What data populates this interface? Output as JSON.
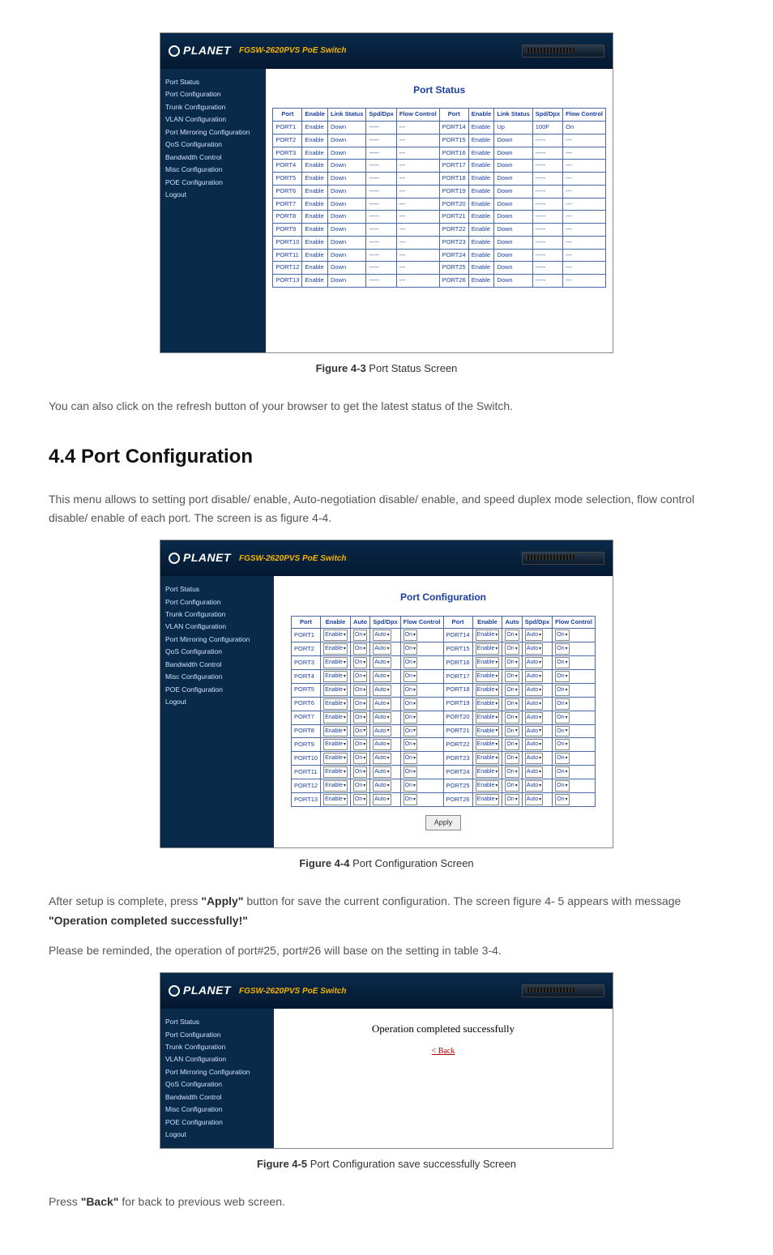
{
  "brand": "PLANET",
  "model": "FGSW-2620PVS PoE Switch",
  "sidebar": {
    "items": [
      "Port Status",
      "Port Configuration",
      "Trunk Configuration",
      "VLAN Configuration",
      "Port Mirroring Configuration",
      "QoS Configuration",
      "Bandwidth Control",
      "Misc Configuration",
      "POE Configuration",
      "Logout"
    ]
  },
  "fig43": {
    "caption_bold": "Figure 4-3",
    "caption_rest": " Port Status Screen",
    "title": "Port Status",
    "headers": [
      "Port",
      "Enable",
      "Link Status",
      "Spd/Dpx",
      "Flow Control",
      "Port",
      "Enable",
      "Link Status",
      "Spd/Dpx",
      "Flow Control"
    ],
    "rows": [
      [
        "PORT1",
        "Enable",
        "Down",
        "-----",
        "---",
        "PORT14",
        "Enable",
        "Up",
        "100F",
        "On"
      ],
      [
        "PORT2",
        "Enable",
        "Down",
        "-----",
        "---",
        "PORT15",
        "Enable",
        "Down",
        "-----",
        "---"
      ],
      [
        "PORT3",
        "Enable",
        "Down",
        "-----",
        "---",
        "PORT16",
        "Enable",
        "Down",
        "-----",
        "---"
      ],
      [
        "PORT4",
        "Enable",
        "Down",
        "-----",
        "---",
        "PORT17",
        "Enable",
        "Down",
        "-----",
        "---"
      ],
      [
        "PORT5",
        "Enable",
        "Down",
        "-----",
        "---",
        "PORT18",
        "Enable",
        "Down",
        "-----",
        "---"
      ],
      [
        "PORT6",
        "Enable",
        "Down",
        "-----",
        "---",
        "PORT19",
        "Enable",
        "Down",
        "-----",
        "---"
      ],
      [
        "PORT7",
        "Enable",
        "Down",
        "-----",
        "---",
        "PORT20",
        "Enable",
        "Down",
        "-----",
        "---"
      ],
      [
        "PORT8",
        "Enable",
        "Down",
        "-----",
        "---",
        "PORT21",
        "Enable",
        "Down",
        "-----",
        "---"
      ],
      [
        "PORT9",
        "Enable",
        "Down",
        "-----",
        "---",
        "PORT22",
        "Enable",
        "Down",
        "-----",
        "---"
      ],
      [
        "PORT10",
        "Enable",
        "Down",
        "-----",
        "---",
        "PORT23",
        "Enable",
        "Down",
        "-----",
        "---"
      ],
      [
        "PORT11",
        "Enable",
        "Down",
        "-----",
        "---",
        "PORT24",
        "Enable",
        "Down",
        "-----",
        "---"
      ],
      [
        "PORT12",
        "Enable",
        "Down",
        "-----",
        "---",
        "PORT25",
        "Enable",
        "Down",
        "-----",
        "---"
      ],
      [
        "PORT13",
        "Enable",
        "Down",
        "-----",
        "---",
        "PORT26",
        "Enable",
        "Down",
        "-----",
        "---"
      ]
    ]
  },
  "text_after_fig43": "You can also click on the refresh button of your browser to get the latest status of the Switch.",
  "section_heading": "4.4 Port Configuration",
  "section_intro": "This menu allows to setting port disable/ enable, Auto-negotiation disable/ enable, and speed duplex mode selection, flow control disable/ enable of each port. The screen is as figure 4-4.",
  "fig44": {
    "caption_bold": "Figure 4-4",
    "caption_rest": " Port Configuration Screen",
    "title": "Port Configuration",
    "headers": [
      "Port",
      "Enable",
      "Auto",
      "Spd/Dpx",
      "Flow Control",
      "Port",
      "Enable",
      "Auto",
      "Spd/Dpx",
      "Flow Control"
    ],
    "left_ports": [
      "PORT1",
      "PORT2",
      "PORT3",
      "PORT4",
      "PORT5",
      "PORT6",
      "PORT7",
      "PORT8",
      "PORT9",
      "PORT10",
      "PORT11",
      "PORT12",
      "PORT13"
    ],
    "right_ports": [
      "PORT14",
      "PORT15",
      "PORT16",
      "PORT17",
      "PORT18",
      "PORT19",
      "PORT20",
      "PORT21",
      "PORT22",
      "PORT23",
      "PORT24",
      "PORT25",
      "PORT26"
    ],
    "sel_enable": "Enable",
    "sel_auto": "On",
    "sel_spd": "Auto",
    "sel_flow": "On",
    "apply_label": "Apply"
  },
  "after_fig44_1a": "After setup is complete, press ",
  "after_fig44_1b": "\"Apply\"",
  "after_fig44_1c": " button for save the current configuration. The screen figure 4- 5 appears with message ",
  "after_fig44_1d": "\"Operation completed successfully!\"",
  "after_fig44_2": "Please be reminded, the operation of port#25, port#26 will base on the setting in table 3-4.",
  "fig45": {
    "caption_bold": "Figure 4-5",
    "caption_rest": " Port Configuration save successfully Screen",
    "message": "Operation completed successfully",
    "back": "< Back"
  },
  "closing_a": "Press ",
  "closing_b": "\"Back\"",
  "closing_c": " for back to previous web screen."
}
